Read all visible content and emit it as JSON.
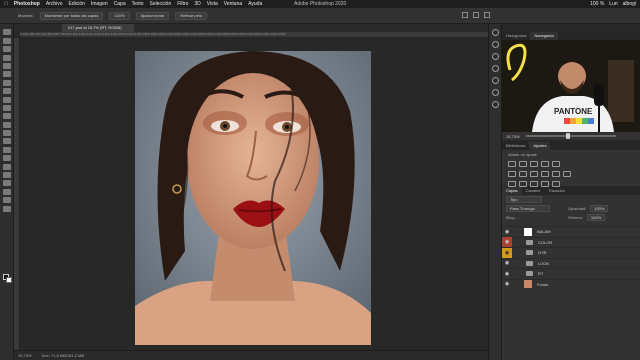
{
  "menubar": {
    "app": "Photoshop",
    "items": [
      "Archivo",
      "Edición",
      "Imagen",
      "Capa",
      "Texto",
      "Selección",
      "Filtro",
      "3D",
      "Vista",
      "Ventana",
      "Ayuda"
    ],
    "window_title": "Adobe Photoshop 2020",
    "status": [
      "100 %",
      "Lun",
      "albogi"
    ]
  },
  "options_bar": {
    "sample_label": "Muestra:",
    "sample_value": "Muestrear por todas las capas",
    "size_value": "100%",
    "adjust_edge": "Ajustar borde",
    "refine_hair": "Refinar pelo"
  },
  "document": {
    "tab_title": "017.psd al 15,7% (RT, RGB/8)",
    "ruler_text": "0 100 200 300 400 500 600 700 800 900 1000 1100 1200 1300 1400 1500 1600 1700 1800 1900 2000 2100 2200 2300 2400 2500 2600 2700 2800 2900 3000 3100 3200 3300 3400 3500",
    "zoom": "15,73%",
    "doc_info": "Doc: 71,6 MB/161,2 MB"
  },
  "navigator": {
    "tabs": [
      "Histograma",
      "Navegador"
    ],
    "active": 1,
    "zoom": "15,73%",
    "shirt_text": "PANTONE"
  },
  "adjustments": {
    "tabs": [
      "Bibliotecas",
      "Ajustes"
    ],
    "active": 1,
    "hint": "Añadir un ajuste"
  },
  "layers": {
    "tabs": [
      "Capas",
      "Canales",
      "Trazados"
    ],
    "active": 0,
    "filter": "Tipo",
    "blend_mode": "Pass Through",
    "opacity_label": "Opacidad:",
    "opacity_value": "100%",
    "lock_label": "Bloq.:",
    "fill_label": "Relleno:",
    "fill_value": "100%",
    "items": [
      {
        "name": "BALAM",
        "kind": "layer",
        "vis": "",
        "thumb": "#ffffff"
      },
      {
        "name": "COLOR",
        "kind": "group",
        "vis": "red",
        "thumb": ""
      },
      {
        "name": "DYB",
        "kind": "group",
        "vis": "on",
        "thumb": ""
      },
      {
        "name": "LOOK",
        "kind": "group",
        "vis": "",
        "thumb": ""
      },
      {
        "name": "RT",
        "kind": "group",
        "vis": "",
        "thumb": ""
      },
      {
        "name": "Fondo",
        "kind": "layer",
        "vis": "",
        "thumb": "#c9876a"
      }
    ]
  },
  "colors": {
    "accent_yellow": "#d19a1e",
    "accent_red": "#a8412f",
    "lip": "#9b1014",
    "skin": "#d8a283",
    "background_wall": "#7b8793"
  }
}
